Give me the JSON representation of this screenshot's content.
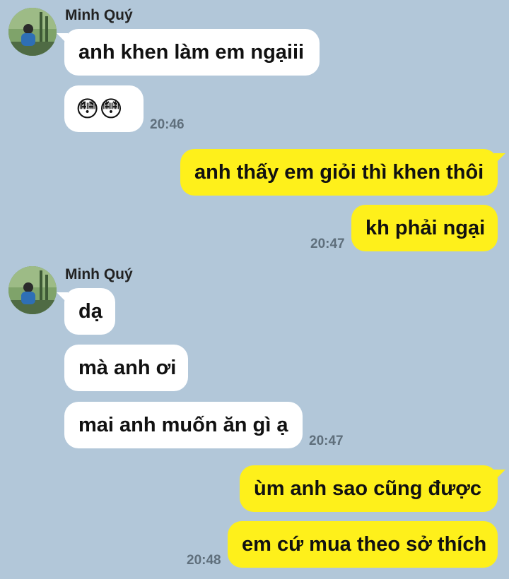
{
  "groups": [
    {
      "sender": "Minh Quý",
      "avatar_icon": "avatar-photo-icon",
      "messages": [
        "anh khen làm em ngạiii",
        "😳😳"
      ],
      "time": "20:46"
    },
    {
      "outgoing_messages": [
        "anh thấy em giỏi thì khen thôi",
        "kh phải ngại"
      ],
      "time": "20:47"
    },
    {
      "sender": "Minh Quý",
      "avatar_icon": "avatar-photo-icon",
      "messages": [
        "dạ",
        "mà anh ơi",
        "mai anh muốn ăn gì ạ"
      ],
      "time": "20:47"
    },
    {
      "outgoing_messages": [
        "ùm anh sao cũng được",
        "em cứ mua theo sở thích"
      ],
      "time": "20:48"
    }
  ],
  "colors": {
    "background": "#b2c7d9",
    "incoming_bubble": "#ffffff",
    "outgoing_bubble": "#fef01b",
    "timestamp": "#5f6f7c"
  }
}
